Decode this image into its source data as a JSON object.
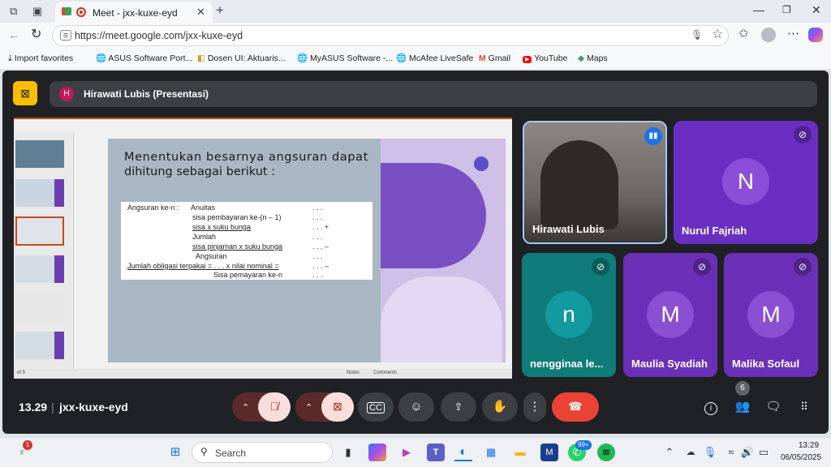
{
  "browser": {
    "tab_title": "Meet - jxx-kuxe-eyd",
    "url": "https://meet.google.com/jxx-kuxe-eyd",
    "bookmarks": [
      {
        "label": "Import favorites"
      },
      {
        "label": "ASUS Software Port..."
      },
      {
        "label": "Dosen UI: Aktuaris..."
      },
      {
        "label": "MyASUS Software -..."
      },
      {
        "label": "McAfee LiveSafe"
      },
      {
        "label": "Gmail"
      },
      {
        "label": "YouTube"
      },
      {
        "label": "Maps"
      }
    ]
  },
  "meet": {
    "presenter_initial": "H",
    "presenter_label": "Hirawati Lubis (Presentasi)",
    "clock": "13.29",
    "meeting_code": "jxx-kuxe-eyd",
    "people_count": "6",
    "colors": {
      "end_call": "#ea4335",
      "mute_bg": "#f9dedc",
      "presbar": "#3c4043",
      "background": "#202124"
    }
  },
  "slide": {
    "heading_line1": "Menentukan besarnya angsuran dapat",
    "heading_line2": "dihitung sebagai berikut :",
    "rows": [
      {
        "c1": "Angsuran ke-n :",
        "c2": "Anuitas",
        "c3": ". . ."
      },
      {
        "c1": "",
        "c2": "sisa pembayaran ke-(n – 1)",
        "c3": ". . ."
      },
      {
        "c1": "",
        "c2": "sisa x suku bunga",
        "c3": ". . . +"
      },
      {
        "c1": "",
        "c2": "Jumlah",
        "c3": ". . ."
      },
      {
        "c1": "",
        "c2": "sisa pinjaman x suku bunga",
        "c3": ". . . –"
      },
      {
        "c1": "",
        "c2": "Angsuran",
        "c3": ". . ."
      },
      {
        "c1": "Jumlah obligasi terpakai  = . . . x nilai nominal =",
        "c2": "",
        "c3": ". . . –"
      },
      {
        "c1": "",
        "c2": "Sisa pemayaran ke-n",
        "c3": ". . ."
      }
    ],
    "status_page": "of 5",
    "status_notes": "Notes",
    "status_comments": "Comments"
  },
  "participants": [
    {
      "name": "Hirawati Lubis",
      "initial": "",
      "color": "#5f5a57"
    },
    {
      "name": "Nurul Fajriah",
      "initial": "N",
      "color": "#6a2fc2"
    },
    {
      "name": "nengginaa le...",
      "initial": "n",
      "color": "#0f7c7a"
    },
    {
      "name": "Maulia Syadiah",
      "initial": "M",
      "color": "#6b2fb8"
    },
    {
      "name": "Malika Sofaul",
      "initial": "M",
      "color": "#6b2fb8"
    }
  ],
  "taskbar": {
    "search_placeholder": "Search",
    "time": "13:29",
    "date": "06/05/2025",
    "badge_left": "1",
    "badge_whatsapp": "99+"
  }
}
